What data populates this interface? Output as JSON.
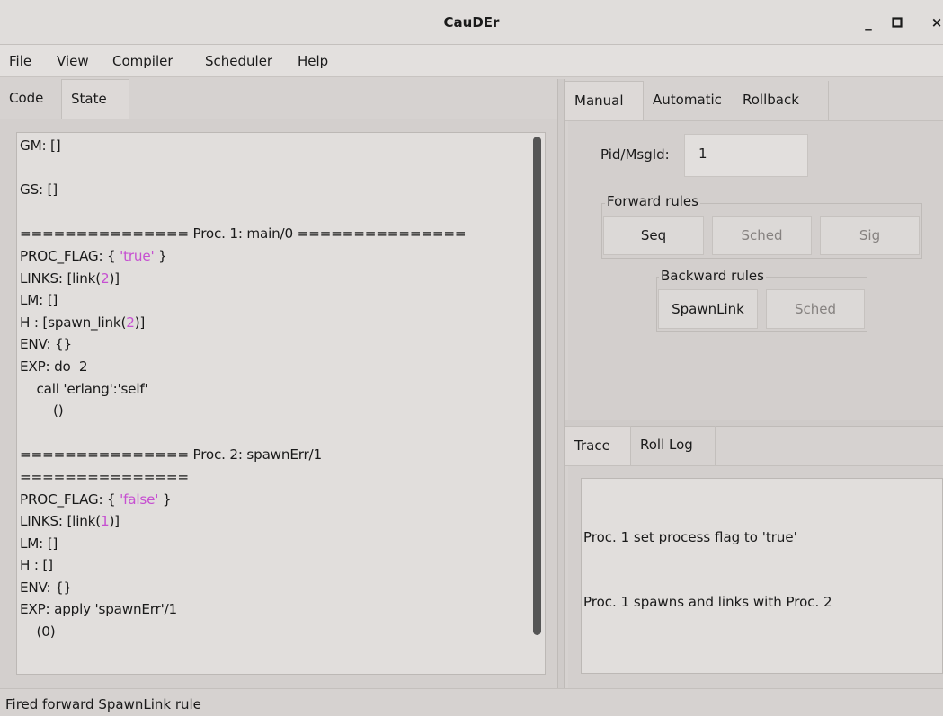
{
  "window": {
    "title": "CauDEr",
    "minimize": "_",
    "maximize": "□",
    "close": "×"
  },
  "menu": [
    "File",
    "View",
    "Compiler",
    "Scheduler",
    "Help"
  ],
  "left_tabs": [
    "Code",
    "State"
  ],
  "state_lines": [
    [
      {
        "t": "GM: []"
      }
    ],
    [
      {
        "t": ""
      }
    ],
    [
      {
        "t": "GS: []"
      }
    ],
    [
      {
        "t": ""
      }
    ],
    [
      {
        "t": "=============== Proc. 1: main/0 ==============="
      }
    ],
    [
      {
        "t": "PROC_FLAG: { "
      },
      {
        "t": "'true'",
        "atom": true
      },
      {
        "t": " }"
      }
    ],
    [
      {
        "t": "LINKS: [link("
      },
      {
        "t": "2",
        "atom": true
      },
      {
        "t": ")]"
      }
    ],
    [
      {
        "t": "LM: []"
      }
    ],
    [
      {
        "t": "H : [spawn_link("
      },
      {
        "t": "2",
        "atom": true
      },
      {
        "t": ")]"
      }
    ],
    [
      {
        "t": "ENV: {}"
      }
    ],
    [
      {
        "t": "EXP: do  2"
      }
    ],
    [
      {
        "t": "    call 'erlang':'self'"
      }
    ],
    [
      {
        "t": "        ()"
      }
    ],
    [
      {
        "t": ""
      }
    ],
    [
      {
        "t": "=============== Proc. 2: spawnErr/1"
      }
    ],
    [
      {
        "t": "==============="
      }
    ],
    [
      {
        "t": "PROC_FLAG: { "
      },
      {
        "t": "'false'",
        "atom": true
      },
      {
        "t": " }"
      }
    ],
    [
      {
        "t": "LINKS: [link("
      },
      {
        "t": "1",
        "atom": true
      },
      {
        "t": ")]"
      }
    ],
    [
      {
        "t": "LM: []"
      }
    ],
    [
      {
        "t": "H : []"
      }
    ],
    [
      {
        "t": "ENV: {}"
      }
    ],
    [
      {
        "t": "EXP: apply 'spawnErr'/1"
      }
    ],
    [
      {
        "t": "    (0)"
      }
    ]
  ],
  "right_tabs": [
    "Manual",
    "Automatic",
    "Rollback"
  ],
  "manual": {
    "pid_label": "Pid/MsgId:",
    "pid_value": "1",
    "forward_label": "Forward rules",
    "forward_buttons": [
      "Seq",
      "Sched",
      "Sig"
    ],
    "backward_label": "Backward rules",
    "backward_buttons": [
      "SpawnLink",
      "Sched"
    ]
  },
  "bottom_tabs": [
    "Trace",
    "Roll Log"
  ],
  "trace_lines": [
    "Proc. 1 set process flag to 'true'",
    "Proc. 1 spawns and links with Proc. 2"
  ],
  "status": "Fired forward SpawnLink rule",
  "colors": {
    "atom": "#c64fd1",
    "background": "#d6d2d0"
  }
}
